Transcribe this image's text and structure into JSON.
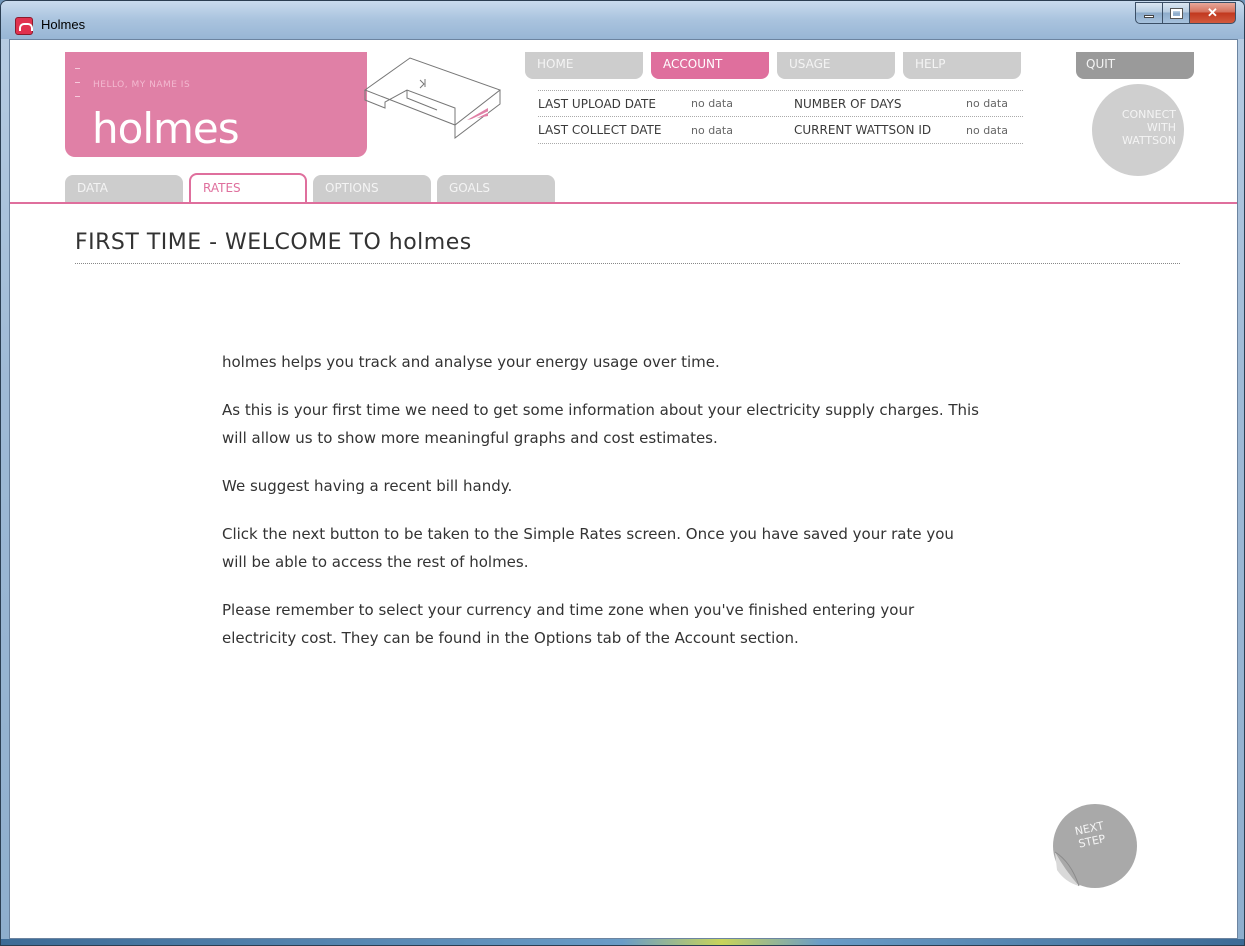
{
  "window": {
    "title": "Holmes"
  },
  "brand": {
    "tagline": "HELLO, MY NAME IS",
    "name": "holmes"
  },
  "topnav": {
    "items": [
      {
        "label": "HOME",
        "active": false
      },
      {
        "label": "ACCOUNT",
        "active": true
      },
      {
        "label": "USAGE",
        "active": false
      },
      {
        "label": "HELP",
        "active": false
      }
    ],
    "quit": "QUIT"
  },
  "info": {
    "last_upload_label": "LAST UPLOAD DATE",
    "last_upload_value": "no data",
    "number_of_days_label": "NUMBER OF DAYS",
    "number_of_days_value": "no data",
    "last_collect_label": "LAST COLLECT DATE",
    "last_collect_value": "no data",
    "wattson_id_label": "CURRENT WATTSON ID",
    "wattson_id_value": "no data"
  },
  "connect": {
    "line1": "CONNECT",
    "line2": "WITH",
    "line3": "WATTSON"
  },
  "tabs": [
    {
      "label": "DATA",
      "active": false
    },
    {
      "label": "RATES",
      "active": true
    },
    {
      "label": "OPTIONS",
      "active": false
    },
    {
      "label": "GOALS",
      "active": false
    }
  ],
  "page": {
    "title": "FIRST TIME - WELCOME TO holmes",
    "paragraphs": [
      "holmes helps you track and analyse your energy usage over time.",
      "As this is your first time we need to get some information about your electricity supply charges.  This will allow us to show more meaningful graphs and cost estimates.",
      "We suggest having a recent bill handy.",
      "Click the next button to be taken to the Simple Rates screen. Once you have saved your rate you will be able to access the rest of holmes.",
      "Please remember to select your currency and time zone when you've finished entering your electricity cost. They can be found in the Options tab of the Account section."
    ]
  },
  "next": {
    "line1": "NEXT",
    "line2": "STEP"
  },
  "colors": {
    "accent": "#df6f9d",
    "inactive": "#cdcdcd",
    "quit": "#9a9a9a"
  }
}
